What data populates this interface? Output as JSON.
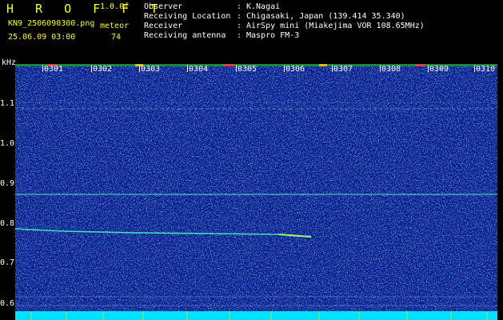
{
  "header": {
    "brand": "H R O F F T",
    "version": "1.0.0f",
    "filename": "KN9_2506090300.png",
    "meteor_label": "meteor",
    "datetime": "25.06.09 03:00",
    "meteor_count": "74"
  },
  "meta": [
    {
      "label": "Observer",
      "value": "K.Nagai"
    },
    {
      "label": "Receiving Location",
      "value": "Chigasaki, Japan (139.414 35.340)"
    },
    {
      "label": "Receiver",
      "value": "AirSpy mini (Miakejima VOR 108.65MHz)"
    },
    {
      "label": "Receiving antenna",
      "value": "Maspro FM-3"
    }
  ],
  "axis": {
    "y_unit": "kHz",
    "y_ticks": [
      "1.1",
      "1.0",
      "0.9",
      "0.8",
      "0.7",
      "0.6"
    ],
    "x_ticks": [
      "0301",
      "0302",
      "0303",
      "0304",
      "0305",
      "0306",
      "0307",
      "0308",
      "0309",
      "0310"
    ]
  },
  "colors": {
    "background": "#000000",
    "plot_bg": "#0a1a8a",
    "header_text": "#ffff00",
    "trace": "#40e0c0",
    "bottom_band": "#00e0ff"
  }
}
